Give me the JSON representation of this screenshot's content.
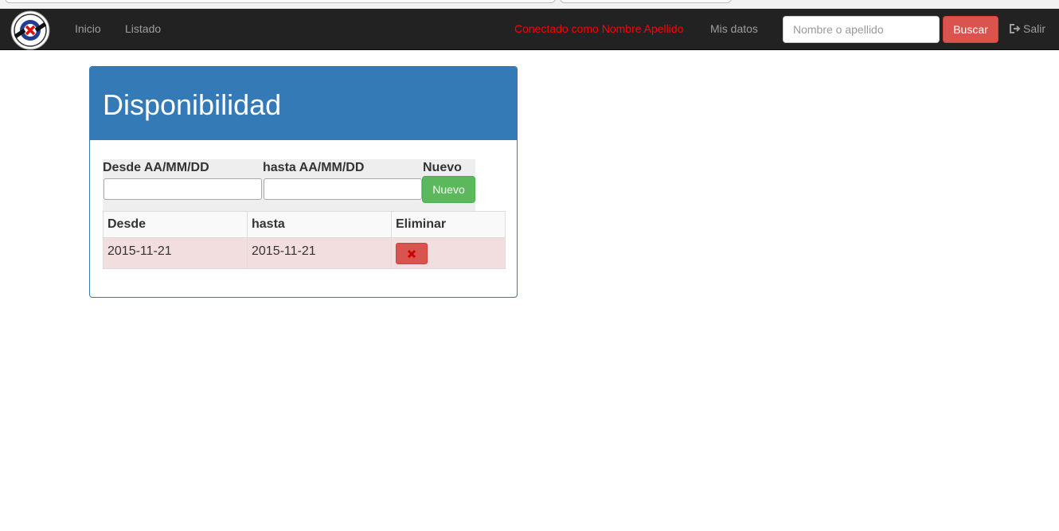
{
  "navbar": {
    "brand_icon": "club-logo-icon",
    "links": [
      {
        "label": "Inicio"
      },
      {
        "label": "Listado"
      }
    ],
    "connected_text": "Conectado como Nombre Apellido",
    "my_data_label": "Mis datos",
    "search": {
      "placeholder": "Nombre o apellido",
      "value": ""
    },
    "search_button_label": "Buscar",
    "logout_label": "Salir",
    "colors": {
      "background": "#222222",
      "connected": "#ff0000",
      "search_button": "#d9534f"
    }
  },
  "panel": {
    "title": "Disponibilidad",
    "header_color": "#337ab7",
    "form": {
      "from_label": "Desde AA/MM/DD",
      "to_label": "hasta AA/MM/DD",
      "new_label": "Nuevo",
      "new_button_label": "Nuevo",
      "from_value": "",
      "to_value": ""
    },
    "table": {
      "headers": [
        "Desde",
        "hasta",
        "Eliminar"
      ],
      "rows": [
        {
          "desde": "2015-11-21",
          "hasta": "2015-11-21",
          "delete_icon": "close-icon"
        }
      ]
    }
  }
}
